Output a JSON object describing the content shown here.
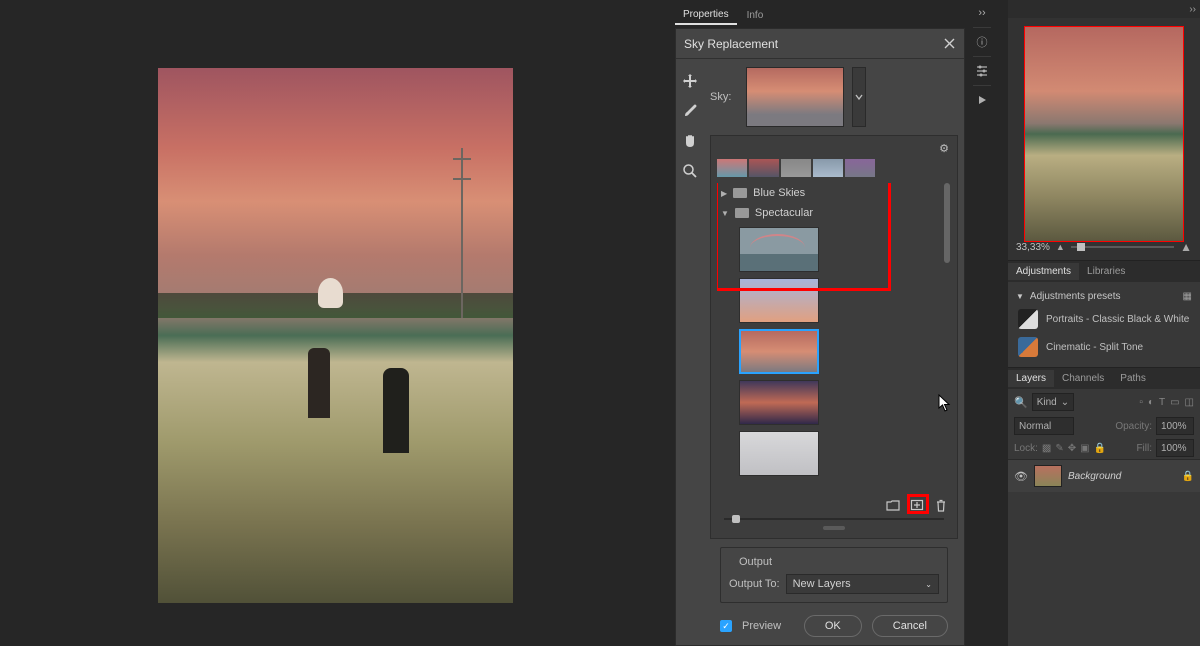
{
  "panels": {
    "properties_tab": "Properties",
    "info_tab": "Info"
  },
  "dialog": {
    "title": "Sky Replacement",
    "sky_label": "Sky:",
    "folders": {
      "blue": "Blue Skies",
      "spectacular": "Spectacular"
    },
    "output_section": "Output",
    "output_to_label": "Output To:",
    "output_to_value": "New Layers",
    "preview_label": "Preview",
    "ok": "OK",
    "cancel": "Cancel"
  },
  "navigator": {
    "zoom": "33,33%"
  },
  "adjustments": {
    "tab_adjustments": "Adjustments",
    "tab_libraries": "Libraries",
    "presets_header": "Adjustments presets",
    "preset1": "Portraits - Classic Black  &  White",
    "preset2": "Cinematic - Split Tone"
  },
  "layers": {
    "tab_layers": "Layers",
    "tab_channels": "Channels",
    "tab_paths": "Paths",
    "kind_label": "Kind",
    "blend_mode": "Normal",
    "opacity_label": "Opacity:",
    "opacity_value": "100%",
    "lock_label": "Lock:",
    "fill_label": "Fill:",
    "fill_value": "100%",
    "layer_name": "Background"
  }
}
